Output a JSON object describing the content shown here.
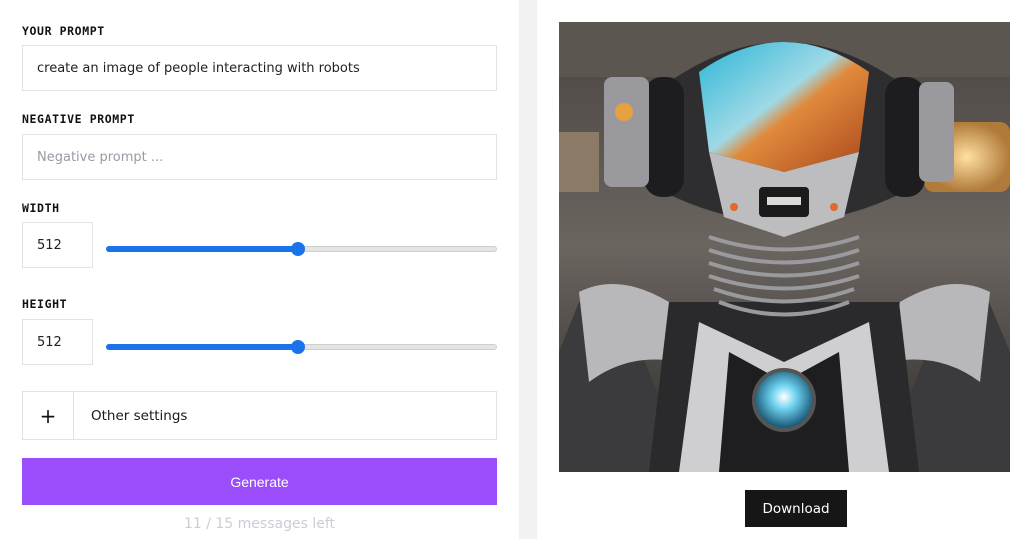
{
  "form": {
    "prompt_label": "YOUR PROMPT",
    "prompt_value": "create an image of people interacting with robots",
    "negative_label": "NEGATIVE PROMPT",
    "negative_placeholder": "Negative prompt ...",
    "width_label": "WIDTH",
    "width_value": "512",
    "height_label": "HEIGHT",
    "height_value": "512",
    "width_slider_fraction": 0.49,
    "height_slider_fraction": 0.49,
    "settings_icon": "+",
    "settings_label": "Other settings",
    "generate_label": "Generate",
    "messages_left": "11 / 15 messages left"
  },
  "result": {
    "download_label": "Download"
  },
  "colors": {
    "accent": "#9b4dfc",
    "slider": "#1a73e8",
    "download_bg": "#161616"
  }
}
